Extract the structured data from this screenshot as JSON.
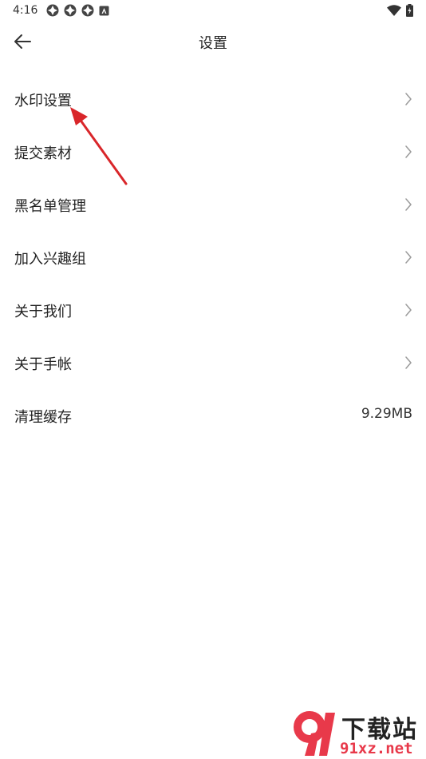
{
  "status_bar": {
    "time": "4:16",
    "left_icons": [
      "notification-icon",
      "notification-icon",
      "notification-icon",
      "app-icon"
    ],
    "right_icons": [
      "wifi-icon",
      "battery-icon"
    ]
  },
  "header": {
    "back_icon": "back-arrow-icon",
    "title": "设置"
  },
  "settings": {
    "items": [
      {
        "label": "水印设置",
        "trailing": "chevron-right-icon"
      },
      {
        "label": "提交素材",
        "trailing": "chevron-right-icon"
      },
      {
        "label": "黑名单管理",
        "trailing": "chevron-right-icon"
      },
      {
        "label": "加入兴趣组",
        "trailing": "chevron-right-icon"
      },
      {
        "label": "关于我们",
        "trailing": "chevron-right-icon"
      },
      {
        "label": "关于手帐",
        "trailing": "chevron-right-icon"
      },
      {
        "label": "清理缓存",
        "value": "9.29MB"
      }
    ]
  },
  "annotation": {
    "color": "#d9262a"
  },
  "watermark": {
    "title": "下载站",
    "url": "91xz.net",
    "accent": "#e8394a"
  }
}
